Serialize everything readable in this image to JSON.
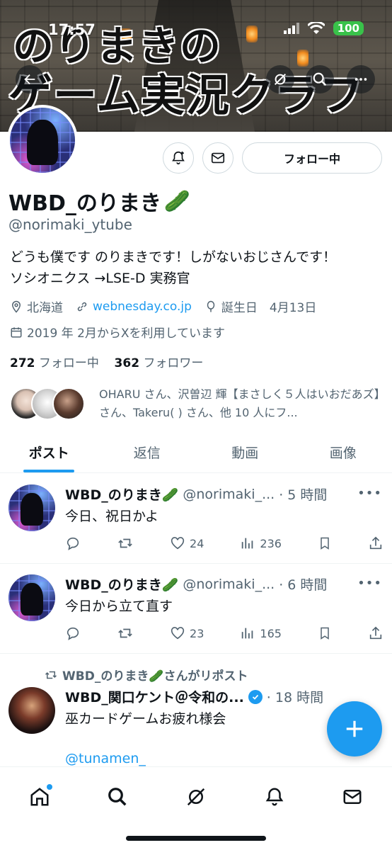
{
  "status_bar": {
    "time": "17:57",
    "battery": "100"
  },
  "banner": {
    "title_line1": "のりまきの",
    "title_line2": "ゲーム実況クラフト"
  },
  "profile": {
    "name": "WBD_のりまき",
    "name_emoji": "🥒",
    "handle": "@norimaki_ytube",
    "bio_line1": "どうも僕です のりまきです！しがないおじさんです！",
    "bio_line2": "ソシオニクス →LSE-D 実務官",
    "location": "北海道",
    "website": "webnesday.co.jp",
    "birthday": "誕生日　4月13日",
    "joined": "2019 年 2月からXを利用しています",
    "following_count": "272",
    "following_label": "フォロー中",
    "followers_count": "362",
    "followers_label": "フォロワー",
    "follow_button": "フォロー中",
    "followed_by": "OHARU さん、沢曽辺 輝【まさしく５人はいおだあズ】さん、Takeru( ) さん、他 10 人にフ..."
  },
  "tabs": [
    "ポスト",
    "返信",
    "動画",
    "画像"
  ],
  "posts": [
    {
      "name": "WBD_のりまき🥒",
      "handle": "@norimaki_...",
      "time": "· 5 時間",
      "text": "今日、祝日かよ",
      "likes": "24",
      "views": "236"
    },
    {
      "name": "WBD_のりまき🥒",
      "handle": "@norimaki_...",
      "time": "· 6 時間",
      "text": "今日から立て直す",
      "likes": "23",
      "views": "165"
    },
    {
      "repost_by": "WBD_のりまき🥒さんがリポスト",
      "name": "WBD_関口ケント＠令和の...",
      "time": "· 18 時間",
      "text": "巫カードゲームお疲れ様会",
      "mention": "@tunamen_"
    }
  ],
  "colors": {
    "accent": "#1d9bf0",
    "text": "#0f1419",
    "muted": "#536471",
    "border": "#cfd9de"
  },
  "icons": {
    "top_nav": [
      "back-arrow-icon",
      "grok-icon",
      "search-icon",
      "more-icon"
    ],
    "bottom_nav": [
      "home-icon",
      "search-icon",
      "grok-icon",
      "notifications-icon",
      "messages-icon"
    ]
  }
}
